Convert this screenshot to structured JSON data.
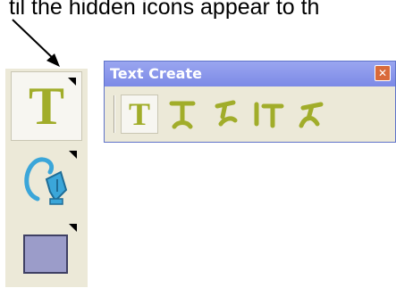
{
  "instruction": {
    "text": "til the hidden icons appear to th"
  },
  "toolbox": {
    "tools": [
      {
        "name": "text-tool",
        "icon": "text-t-icon",
        "glyph": "T",
        "selected": true
      },
      {
        "name": "pen-tool",
        "icon": "pen-nib-icon",
        "selected": false
      },
      {
        "name": "rectangle-tool",
        "icon": "rectangle-icon",
        "selected": false
      }
    ]
  },
  "panel": {
    "title": "Text Create",
    "close_glyph": "✕",
    "tools": [
      {
        "name": "horizontal-text",
        "icon": "text-horizontal-icon",
        "glyph": "T",
        "selected": true
      },
      {
        "name": "vertical-text",
        "icon": "text-vertical-icon",
        "selected": false
      },
      {
        "name": "text-on-path",
        "icon": "text-on-path-icon",
        "selected": false
      },
      {
        "name": "vertical-path-text",
        "icon": "text-vertical-path-icon",
        "selected": false
      },
      {
        "name": "freeform-path-text",
        "icon": "text-freeform-path-icon",
        "selected": false
      }
    ]
  },
  "colors": {
    "accent_text": "#a1ad2a",
    "pen_blue": "#3ba6d9",
    "rect_fill": "#9b9cc9",
    "titlebar": "#8793ea",
    "close": "#d96a3a"
  }
}
